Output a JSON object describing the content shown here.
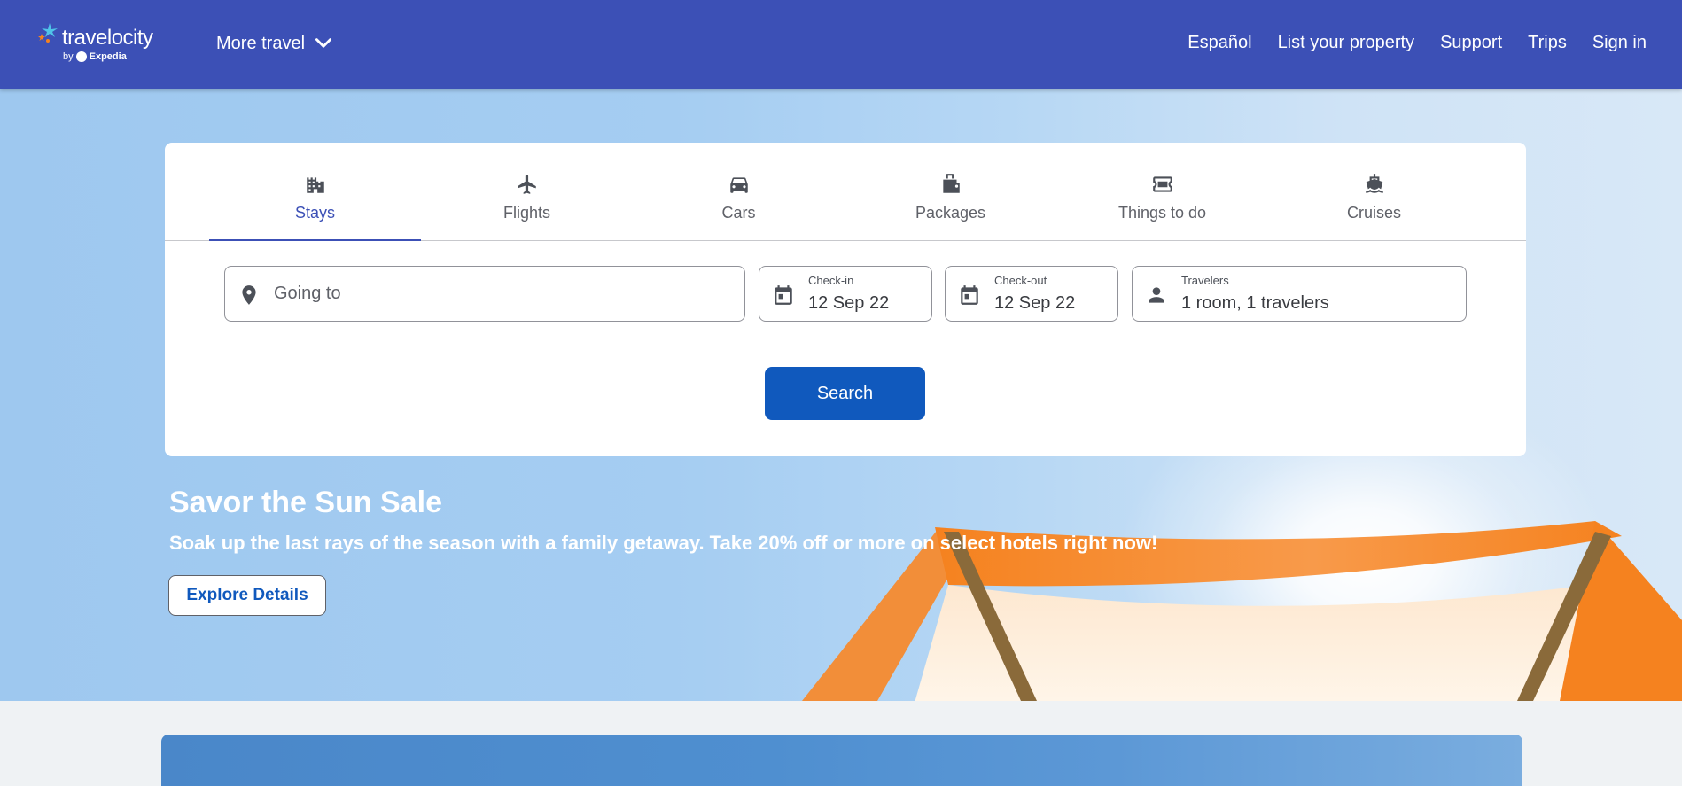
{
  "header": {
    "brand": "travelocity",
    "brand_by": "by",
    "brand_parent": "Expedia",
    "more_travel": "More travel",
    "nav": [
      "Español",
      "List your property",
      "Support",
      "Trips",
      "Sign in"
    ]
  },
  "search": {
    "tabs": [
      {
        "label": "Stays",
        "icon": "building-icon",
        "active": true
      },
      {
        "label": "Flights",
        "icon": "airplane-icon",
        "active": false
      },
      {
        "label": "Cars",
        "icon": "car-icon",
        "active": false
      },
      {
        "label": "Packages",
        "icon": "luggage-icon",
        "active": false
      },
      {
        "label": "Things to do",
        "icon": "ticket-icon",
        "active": false
      },
      {
        "label": "Cruises",
        "icon": "ship-icon",
        "active": false
      }
    ],
    "going_to": {
      "placeholder": "Going to"
    },
    "check_in": {
      "label": "Check-in",
      "value": "12 Sep 22"
    },
    "check_out": {
      "label": "Check-out",
      "value": "12 Sep 22"
    },
    "travelers": {
      "label": "Travelers",
      "value": "1 room, 1 travelers"
    },
    "search_button": "Search"
  },
  "promo": {
    "title": "Savor the Sun Sale",
    "subtitle": "Soak up the last rays of the season with a family getaway. Take 20% off or more on select hotels right now!",
    "button": "Explore Details"
  },
  "colors": {
    "header_bg": "#3c50b6",
    "active_tab": "#3c50b6",
    "primary_button": "#1059bd",
    "canopy_orange": "#f5821f"
  }
}
